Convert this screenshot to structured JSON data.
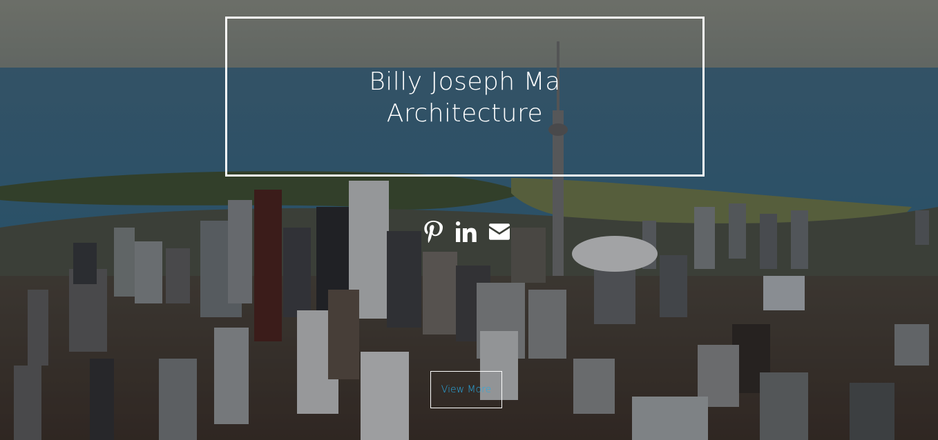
{
  "hero": {
    "title_line1": "Billy Joseph Ma",
    "title_line2": "Architecture",
    "background_icon": "city-skyline-photo"
  },
  "social": [
    {
      "icon": "pinterest-icon"
    },
    {
      "icon": "linkedin-icon"
    },
    {
      "icon": "email-icon"
    }
  ],
  "cta": {
    "label": "View More",
    "color": "#29a9e1"
  }
}
